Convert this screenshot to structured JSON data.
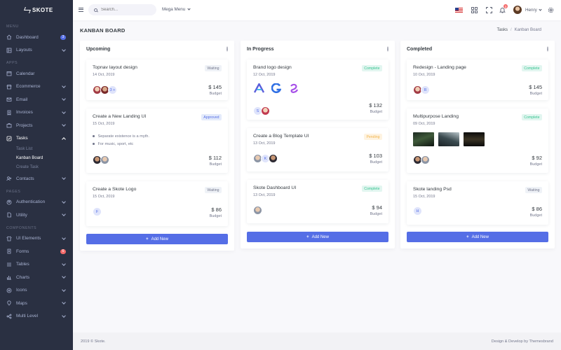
{
  "brand": {
    "name": "SKOTE"
  },
  "sidebar": {
    "sections": {
      "menu": "Menu",
      "apps": "Apps",
      "pages": "Pages",
      "components": "Components"
    },
    "items": [
      {
        "label": "Dashboard",
        "icon": "home-icon",
        "badge": "3",
        "badge_color": "#556ee6"
      },
      {
        "label": "Layouts",
        "icon": "layout-icon"
      },
      {
        "label": "Calendar",
        "icon": "calendar-icon"
      },
      {
        "label": "Ecommerce",
        "icon": "store-icon"
      },
      {
        "label": "Email",
        "icon": "envelope-icon"
      },
      {
        "label": "Invoices",
        "icon": "receipt-icon"
      },
      {
        "label": "Projects",
        "icon": "briefcase-icon"
      },
      {
        "label": "Tasks",
        "icon": "task-icon"
      },
      {
        "label": "Contacts",
        "icon": "contacts-icon"
      },
      {
        "label": "Authentication",
        "icon": "user-circle-icon"
      },
      {
        "label": "Utility",
        "icon": "file-icon"
      },
      {
        "label": "UI Elements",
        "icon": "tshirt-icon"
      },
      {
        "label": "Forms",
        "icon": "receipt-icon",
        "badge": "6",
        "badge_color": "#f46a6a"
      },
      {
        "label": "Tables",
        "icon": "list-icon"
      },
      {
        "label": "Charts",
        "icon": "bar-chart-icon"
      },
      {
        "label": "Icons",
        "icon": "aperture-icon"
      },
      {
        "label": "Maps",
        "icon": "map-icon"
      },
      {
        "label": "Multi Level",
        "icon": "share-icon"
      }
    ],
    "tasks_sub": [
      "Task List",
      "Kanban Board",
      "Create Task"
    ]
  },
  "topbar": {
    "search_placeholder": "Search...",
    "mega_menu": "Mega Menu",
    "notification_count": "3",
    "user_name": "Henry"
  },
  "page": {
    "title": "KANBAN BOARD",
    "breadcrumb": [
      "Tasks",
      "/",
      "Kanban Board"
    ]
  },
  "columns": [
    {
      "title": "Upcoming",
      "tasks": [
        {
          "title": "Topnav layout design",
          "date": "14 Oct, 2019",
          "status": "Waiting",
          "price": "$ 145",
          "budget": "Budget"
        },
        {
          "title": "Create a New Landing UI",
          "date": "15 Oct, 2019",
          "status": "Approved",
          "bullets": [
            "Separate existence is a myth.",
            "For music, sport, etc"
          ],
          "price": "$ 112",
          "budget": "Budget"
        },
        {
          "title": "Create a Skote Logo",
          "date": "15 Oct, 2019",
          "status": "Waiting",
          "avatar_letter": "F",
          "price": "$ 86",
          "budget": "Budget"
        }
      ],
      "more_avatars": "3 +",
      "add_label": "Add New"
    },
    {
      "title": "In Progress",
      "tasks": [
        {
          "title": "Brand logo design",
          "date": "12 Oct, 2019",
          "status": "Complete",
          "avatar_letter": "S",
          "price": "$ 132",
          "budget": "Budget"
        },
        {
          "title": "Create a Blog Template UI",
          "date": "13 Oct, 2019",
          "status": "Pending",
          "avatar_letter": "K",
          "price": "$ 103",
          "budget": "Budget"
        },
        {
          "title": "Skote Dashboard UI",
          "date": "13 Oct, 2019",
          "status": "Complete",
          "price": "$ 94",
          "budget": "Budget"
        }
      ],
      "add_label": "Add New"
    },
    {
      "title": "Completed",
      "tasks": [
        {
          "title": "Redesign - Landing page",
          "date": "10 Oct, 2019",
          "status": "Complete",
          "avatar_letter": "R",
          "price": "$ 145",
          "budget": "Budget"
        },
        {
          "title": "Multipurpose Landing",
          "date": "09 Oct, 2019",
          "status": "Complete",
          "price": "$ 92",
          "budget": "Budget"
        },
        {
          "title": "Skote landing Psd",
          "date": "15 Oct, 2019",
          "status": "Waiting",
          "avatar_letter": "H",
          "price": "$ 86",
          "budget": "Budget"
        }
      ],
      "add_label": "Add New"
    }
  ],
  "footer": {
    "left": "2019 © Skote.",
    "right": "Design & Develop by Themesbrand"
  },
  "colors": {
    "sidebar_bg": "#2a3042",
    "primary": "#556ee6",
    "success": "#34c38f",
    "warning": "#f1b44c",
    "danger": "#f46a6a"
  }
}
